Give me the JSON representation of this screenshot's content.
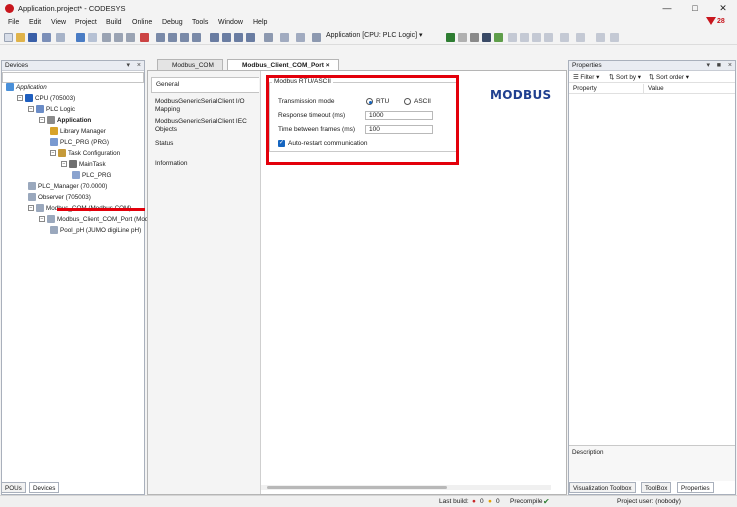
{
  "window": {
    "title": "Application.project* - CODESYS",
    "brand_num": "28",
    "min": "—",
    "max": "□",
    "close": "✕"
  },
  "menu": [
    "File",
    "Edit",
    "View",
    "Project",
    "Build",
    "Online",
    "Debug",
    "Tools",
    "Window",
    "Help"
  ],
  "toolbar": {
    "app_combo": "Application [CPU: PLC Logic]"
  },
  "devices": {
    "title": "Devices",
    "tree": [
      {
        "label": "Application",
        "italic": true,
        "indent": 0,
        "exp": "",
        "icon": "#4a90d9"
      },
      {
        "label": "CPU (705003)",
        "indent": 1,
        "exp": "−",
        "icon": "#1f5fbf"
      },
      {
        "label": "PLC Logic",
        "indent": 2,
        "exp": "−",
        "icon": "#6a8cc7"
      },
      {
        "label": "Application",
        "bold": true,
        "indent": 3,
        "exp": "−",
        "icon": "#8a8a8a"
      },
      {
        "label": "Library Manager",
        "indent": 4,
        "exp": "",
        "icon": "#d8a32a"
      },
      {
        "label": "PLC_PRG (PRG)",
        "indent": 4,
        "exp": "",
        "icon": "#7a9ad0"
      },
      {
        "label": "Task Configuration",
        "indent": 4,
        "exp": "−",
        "icon": "#c59a3a"
      },
      {
        "label": "MainTask",
        "indent": 5,
        "exp": "−",
        "icon": "#6f6f6f"
      },
      {
        "label": "PLC_PRG",
        "indent": 6,
        "exp": "",
        "icon": "#8aa3cf"
      },
      {
        "label": "PLC_Manager (70.0000)",
        "indent": 2,
        "exp": "",
        "icon": "#9aa8bd"
      },
      {
        "label": "Observer (705003)",
        "indent": 2,
        "exp": "",
        "icon": "#9aa8bd"
      },
      {
        "label": "Modbus_COM (Modbus COM)",
        "indent": 2,
        "exp": "−",
        "icon": "#9aa8bd"
      },
      {
        "label": "Modbus_Client_COM_Port (Modbus",
        "indent": 3,
        "exp": "−",
        "icon": "#9aa8bd"
      },
      {
        "label": "Pool_pH (JUMO digiLine pH)",
        "indent": 4,
        "exp": "",
        "icon": "#9aa8bd"
      }
    ],
    "tabs": [
      "POUs",
      "Devices"
    ]
  },
  "editor": {
    "tabs": [
      "Modbus_COM",
      "Modbus_Client_COM_Port"
    ],
    "sidebar": [
      "General",
      "ModbusGenericSerialClient I/O Mapping",
      "ModbusGenericSerialClient IEC Objects",
      "Status",
      "Information"
    ],
    "group_title": "Modbus RTU/ASCII",
    "transmission_label": "Transmission mode",
    "rtu": "RTU",
    "ascii": "ASCII",
    "response_label": "Response timeout (ms)",
    "response_value": "1000",
    "between_label": "Time between frames (ms)",
    "between_value": "100",
    "autorestart": "Auto-restart communication",
    "logo": "MODBUS"
  },
  "properties": {
    "title": "Properties",
    "filter": "Filter",
    "sortby": "Sort by",
    "sortorder": "Sort order",
    "col_property": "Property",
    "col_value": "Value",
    "description": "Description",
    "tabs": [
      "Visualization Toolbox",
      "ToolBox",
      "Properties"
    ]
  },
  "status": {
    "last_build": "Last build:",
    "err": "0",
    "warn": "0",
    "precompile": "Precompile",
    "user": "Project user: (nobody)"
  },
  "colors": {
    "accent": "#1565c0",
    "highlight": "#e3000b",
    "brand": "#c8161d"
  }
}
